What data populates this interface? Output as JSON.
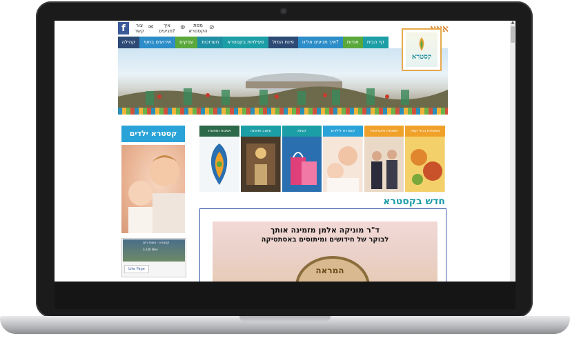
{
  "topbar": {
    "contact_label": "צור קשר",
    "arrive_label": "איך מגיעים?",
    "map_label": "מפת הקסטרא",
    "font_size_control": "אאא",
    "facebook_glyph": "f"
  },
  "nav": {
    "items": [
      {
        "label": "דף הבית",
        "color": "#1c9ea6"
      },
      {
        "label": "אודות",
        "color": "#5aa83c"
      },
      {
        "label": "איך מגיעים אלינו?",
        "color": "#2c8dc8"
      },
      {
        "label": "פינת המזל",
        "color": "#2d4a75"
      },
      {
        "label": "פעילויות בקסטרא",
        "color": "#1c9ea6"
      },
      {
        "label": "תערוכות",
        "color": "#1f8fa4"
      },
      {
        "label": "עסקים",
        "color": "#5aa83c"
      },
      {
        "label": "אירועים בחוף",
        "color": "#2c8dc8"
      },
      {
        "label": "קהילה",
        "color": "#2d4a75"
      }
    ]
  },
  "logo": {
    "name": "קסטרא"
  },
  "sidebar": {
    "kids_banner": "קסטרא ילדים",
    "fb_page_title": "קסטרא - חוצות הים",
    "fb_page_likes": "3,130 likes",
    "fb_like_button": "Like Page"
  },
  "tiles": [
    {
      "label": "מסעדות ובתי קפה",
      "color": "#f0a12a",
      "image": "food"
    },
    {
      "label": "אומנות ותערוכות",
      "color": "#f0a12a",
      "image": "people"
    },
    {
      "label": "קסטרא לילדים",
      "color": "#2aa3d8",
      "image": "kids"
    },
    {
      "label": "קניות",
      "color": "#1c9ea6",
      "image": "shopping"
    },
    {
      "label": "עיצוב ואופנה",
      "color": "#1c9ea6",
      "image": "fashion"
    },
    {
      "label": "אמנות ומתנות",
      "color": "#2d6a4a",
      "image": "art"
    }
  ],
  "news": {
    "title": "חדש בקסטרא",
    "line1": "ד\"ר מוניקה אלמן מזמינה אותך",
    "line2": "לבוקר של חידושים ומיתוסים באסתטיקה",
    "mirror_text": "המראה"
  }
}
